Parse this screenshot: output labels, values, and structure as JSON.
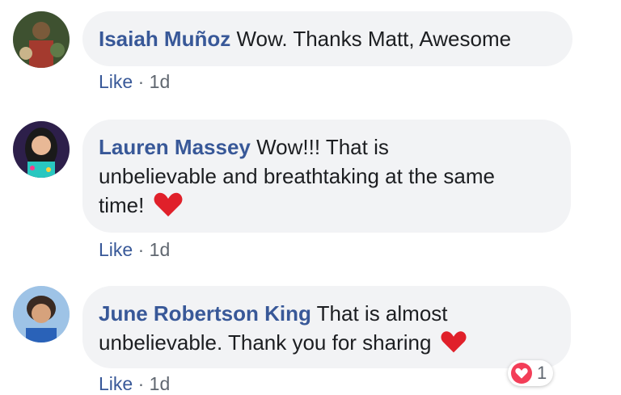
{
  "comments": [
    {
      "author": "Isaiah Muñoz",
      "text": "Wow. Thanks Matt, Awesome",
      "like_label": "Like",
      "separator": "·",
      "time": "1d",
      "avatar_icon": "user-avatar"
    },
    {
      "author": "Lauren Massey",
      "text_line1": "Wow!!! That is",
      "text_line2": "unbelievable and breathtaking at the same",
      "text_line3": "time!",
      "emoji": "red-heart",
      "like_label": "Like",
      "separator": "·",
      "time": "1d",
      "avatar_icon": "user-avatar"
    },
    {
      "author": "June Robertson King",
      "text_line1": "That is almost",
      "text_line2": "unbelievable. Thank you for sharing",
      "emoji": "red-heart",
      "reaction": "love-reaction",
      "reaction_count": "1",
      "like_label": "Like",
      "separator": "·",
      "time": "1d",
      "avatar_icon": "user-avatar"
    }
  ],
  "colors": {
    "author": "#385898",
    "bubble": "#f2f3f5",
    "text": "#1c1e21",
    "meta": "#606770",
    "heart": "#e0202a",
    "love_reaction": "#f33e58"
  }
}
